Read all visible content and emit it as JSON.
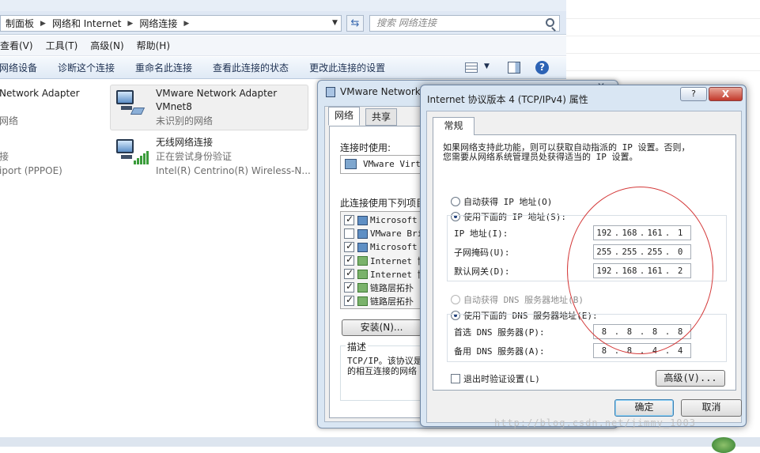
{
  "explorer": {
    "breadcrumbs": [
      "制面板",
      "网络和 Internet",
      "网络连接"
    ],
    "search_placeholder": "搜索 网络连接",
    "menu": [
      "查看(V)",
      "工具(T)",
      "高级(N)",
      "帮助(H)"
    ],
    "commands": [
      "网络设备",
      "诊断这个连接",
      "重命名此连接",
      "查看此连接的状态",
      "更改此连接的设置"
    ],
    "adapters": [
      {
        "title": "Network Adapter",
        "sub1": "网络",
        "sub2": ""
      },
      {
        "title": "VMware Network Adapter",
        "sub1": "VMnet8",
        "sub2": "未识别的网络"
      },
      {
        "title": "",
        "sub1": "接",
        "sub2": "iport (PPPOE)"
      },
      {
        "title": "无线网络连接",
        "sub1": "正在尝试身份验证",
        "sub2": "Intel(R) Centrino(R) Wireless-N..."
      }
    ]
  },
  "local_dialog": {
    "title": "VMware Network",
    "tabs": [
      "网络",
      "共享"
    ],
    "connect_using_label": "连接时使用:",
    "connect_using_value": "VMware Virtu",
    "items_label": "此连接使用下列项目",
    "items": [
      {
        "label": "Microsoft",
        "checked": true,
        "icon": "client"
      },
      {
        "label": "VMware Bri",
        "checked": false,
        "icon": "client"
      },
      {
        "label": "Microsoft",
        "checked": true,
        "icon": "client"
      },
      {
        "label": "Internet 协",
        "checked": true,
        "icon": "proto"
      },
      {
        "label": "Internet 协",
        "checked": true,
        "icon": "proto"
      },
      {
        "label": "链路层拓扑",
        "checked": true,
        "icon": "proto"
      },
      {
        "label": "链路层拓扑",
        "checked": true,
        "icon": "proto"
      }
    ],
    "install_button": "安装(N)...",
    "description_label": "描述",
    "description_text": "TCP/IP。该协议是\n的相互连接的网络"
  },
  "ipv4_dialog": {
    "title": "Internet 协议版本 4 (TCP/IPv4) 属性",
    "help_glyph": "?",
    "close_glyph": "X",
    "tab_general": "常规",
    "intro_line1": "如果网络支持此功能，则可以获取自动指派的 IP 设置。否则，",
    "intro_line2": "您需要从网络系统管理员处获得适当的 IP 设置。",
    "auto_ip": "自动获得 IP 地址(O)",
    "manual_ip": "使用下面的 IP 地址(S):",
    "ip_label": "IP 地址(I):",
    "ip_value": [
      "192",
      "168",
      "161",
      "1"
    ],
    "mask_label": "子网掩码(U):",
    "mask_value": [
      "255",
      "255",
      "255",
      "0"
    ],
    "gateway_label": "默认网关(D):",
    "gateway_value": [
      "192",
      "168",
      "161",
      "2"
    ],
    "auto_dns": "自动获得 DNS 服务器地址(B)",
    "manual_dns": "使用下面的 DNS 服务器地址(E):",
    "dns1_label": "首选 DNS 服务器(P):",
    "dns1_value": [
      "8",
      "8",
      "8",
      "8"
    ],
    "dns2_label": "备用 DNS 服务器(A):",
    "dns2_value": [
      "8",
      "8",
      "4",
      "4"
    ],
    "validate_label": "退出时验证设置(L)",
    "advanced_button": "高级(V)...",
    "ok_button": "确定",
    "cancel_button": "取消"
  },
  "watermark": "http://blog.csdn.net/jimmy_1003",
  "colors": {
    "annotation": "#d43a3a",
    "accent": "#2d63b5"
  }
}
